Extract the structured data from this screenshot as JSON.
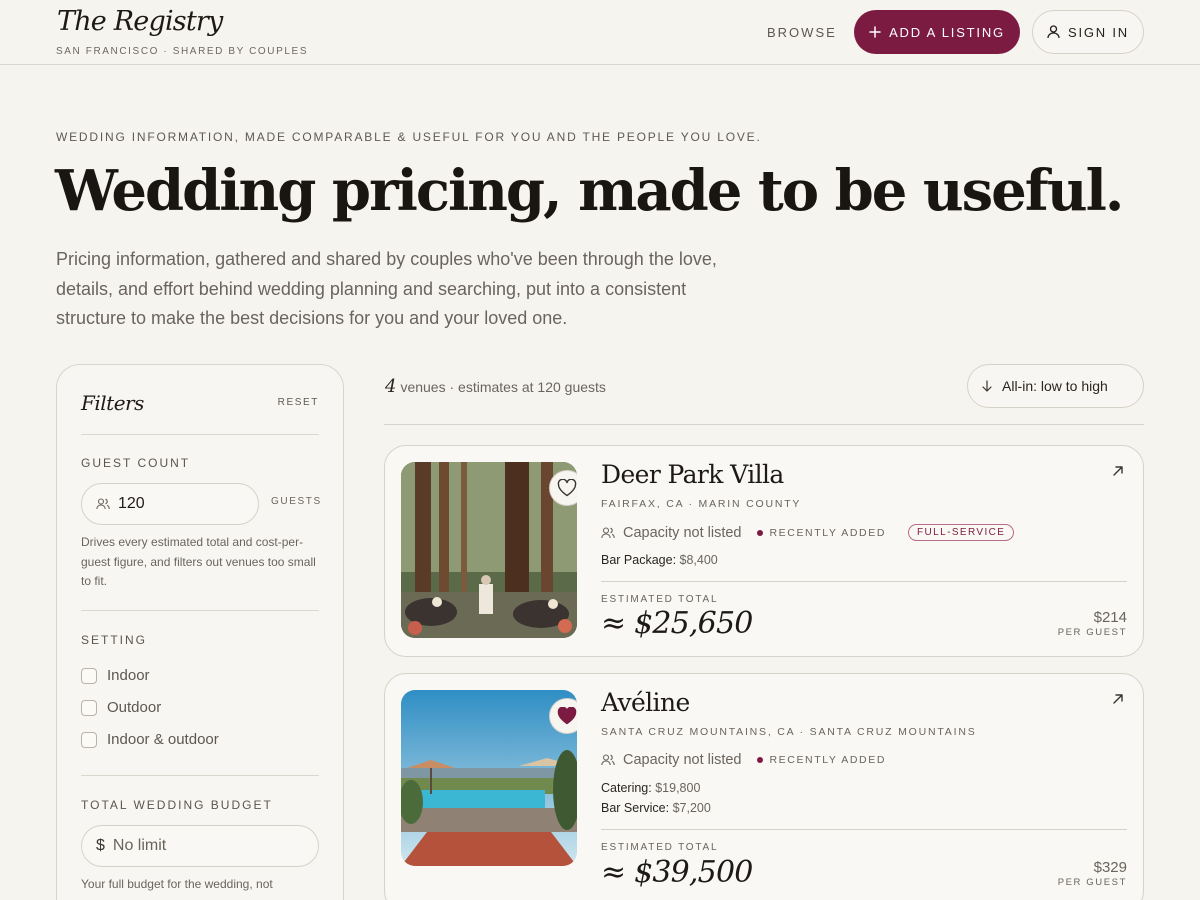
{
  "header": {
    "brand": "The Registry",
    "tagline": "SAN FRANCISCO · SHARED BY COUPLES",
    "browse_label": "BROWSE",
    "add_listing_label": "ADD A LISTING",
    "sign_in_label": "SIGN IN"
  },
  "hero": {
    "eyebrow": "WEDDING INFORMATION, MADE COMPARABLE & USEFUL FOR YOU AND THE PEOPLE YOU LOVE.",
    "title": "Wedding pricing, made to be useful.",
    "subtitle": "Pricing information, gathered and shared by couples who've been through the love, details, and effort behind wedding planning and searching, put into a consistent structure to make the best decisions for you and your loved one."
  },
  "filters": {
    "title": "Filters",
    "reset_label": "RESET",
    "guest_count": {
      "label": "GUEST COUNT",
      "value": "120",
      "suffix": "GUESTS",
      "help": "Drives every estimated total and cost-per-guest figure, and filters out venues too small to fit."
    },
    "setting": {
      "label": "SETTING",
      "options": [
        "Indoor",
        "Outdoor",
        "Indoor & outdoor"
      ]
    },
    "budget": {
      "label": "TOTAL WEDDING BUDGET",
      "currency": "$",
      "placeholder": "No limit",
      "help": "Your full budget for the wedding, not"
    }
  },
  "results": {
    "count": "4",
    "count_text": "venues · estimates at 120 guests",
    "sort_label": "All-in: low to high"
  },
  "venues": [
    {
      "name": "Deer Park Villa",
      "location": "FAIRFAX, CA · MARIN COUNTY",
      "capacity": "Capacity not listed",
      "recent": "RECENTLY ADDED",
      "tag": "FULL-SERVICE",
      "favorited": false,
      "costs": [
        {
          "label": "Bar Package:",
          "value": "$8,400"
        }
      ],
      "est_label": "ESTIMATED TOTAL",
      "est_total": "≈ $25,650",
      "per_guest": "$214",
      "per_guest_label": "PER GUEST"
    },
    {
      "name": "Avéline",
      "location": "SANTA CRUZ MOUNTAINS, CA · SANTA CRUZ MOUNTAINS",
      "capacity": "Capacity not listed",
      "recent": "RECENTLY ADDED",
      "tag": "",
      "favorited": true,
      "costs": [
        {
          "label": "Catering:",
          "value": "$19,800"
        },
        {
          "label": "Bar Service:",
          "value": "$7,200"
        }
      ],
      "est_label": "ESTIMATED TOTAL",
      "est_total": "≈ $39,500",
      "per_guest": "$329",
      "per_guest_label": "PER GUEST"
    }
  ],
  "colors": {
    "accent": "#7c1b42",
    "background": "#f6f4ef",
    "border": "#d7d2c9",
    "muted_text": "#6a645d"
  }
}
